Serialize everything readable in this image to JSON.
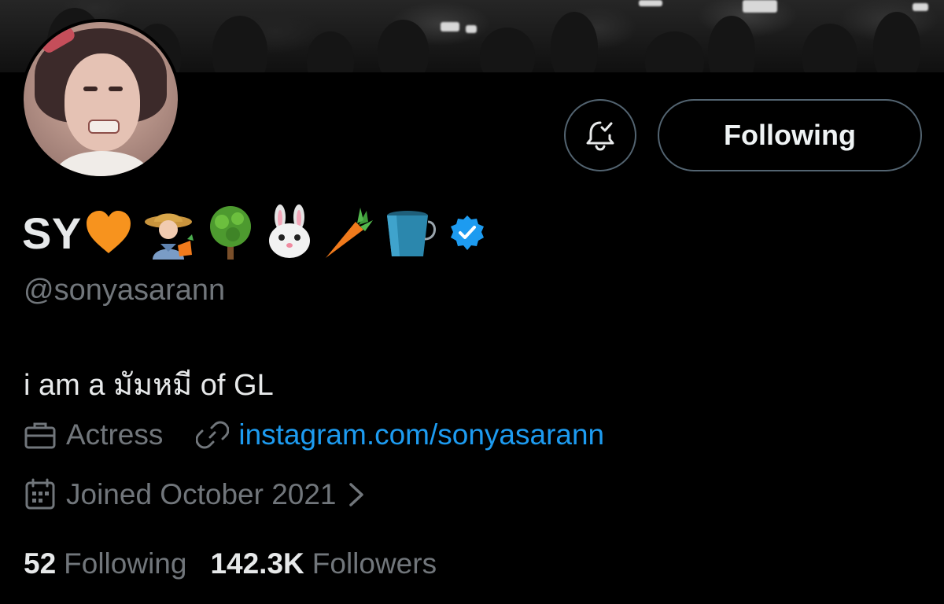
{
  "profile": {
    "display_name": "SY",
    "name_emojis": [
      "orange-heart",
      "farmer",
      "tree",
      "rabbit-face",
      "carrot",
      "bucket"
    ],
    "verified": true,
    "handle": "@sonyasarann",
    "bio": "i am a มัมหมี of GL",
    "occupation": "Actress",
    "website": "instagram.com/sonyasarann",
    "joined": "Joined October 2021"
  },
  "actions": {
    "notify_icon": "bell-check-icon",
    "follow_label": "Following"
  },
  "stats": {
    "following_count": "52",
    "following_label": "Following",
    "followers_count": "142.3K",
    "followers_label": "Followers"
  },
  "colors": {
    "background": "#000000",
    "muted_text": "#71767b",
    "link": "#1d9bf0",
    "verified": "#1d9bf0",
    "button_border": "#536471"
  }
}
